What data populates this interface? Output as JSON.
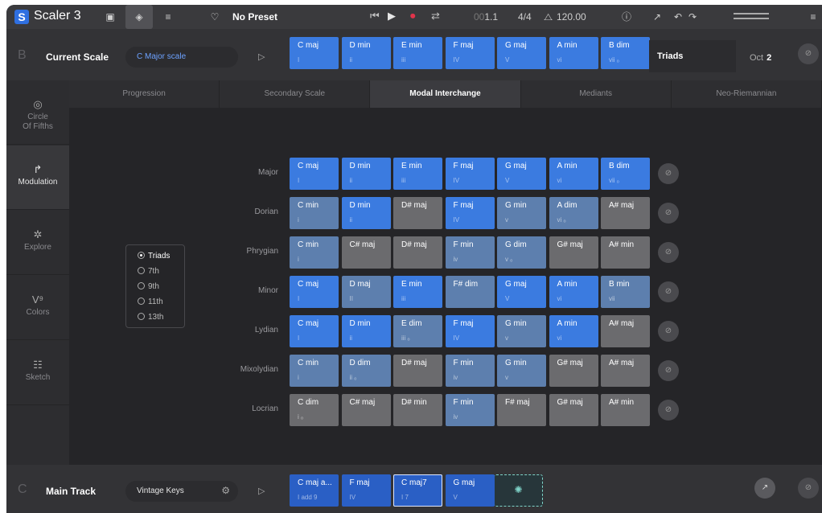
{
  "topbar": {
    "logo_letter": "S",
    "app_title": "Scaler 3",
    "preset": "No Preset",
    "position_dim": "00",
    "position": "1.1",
    "time_signature": "4/4",
    "tempo": "120.00",
    "tempo_icon": "metronome-icon"
  },
  "scale_row": {
    "letter": "B",
    "name": "Current Scale",
    "scale_value": "C Major scale",
    "chords": [
      {
        "name": "C maj",
        "roman": "I"
      },
      {
        "name": "D min",
        "roman": "ii"
      },
      {
        "name": "E min",
        "roman": "iii"
      },
      {
        "name": "F maj",
        "roman": "IV"
      },
      {
        "name": "G maj",
        "roman": "V"
      },
      {
        "name": "A min",
        "roman": "vi"
      },
      {
        "name": "B dim",
        "roman": "vii ₒ"
      }
    ],
    "chord_type": "Triads",
    "octave_label": "Oct",
    "octave_value": "2"
  },
  "sidebar": {
    "items": [
      {
        "label": "Circle\nOf Fifths",
        "icon": "◎"
      },
      {
        "label": "Modulation",
        "icon": "↱"
      },
      {
        "label": "Explore",
        "icon": "✲"
      },
      {
        "label": "Colors",
        "icon": "V⁹"
      },
      {
        "label": "Sketch",
        "icon": "☷"
      }
    ],
    "active_index": 1
  },
  "tabs": [
    "Progression",
    "Secondary Scale",
    "Modal Interchange",
    "Mediants",
    "Neo-Riemannian"
  ],
  "active_tab": 2,
  "modes": [
    {
      "name": "Major",
      "chords": [
        {
          "n": "C maj",
          "r": "I",
          "c": "blue"
        },
        {
          "n": "D min",
          "r": "ii",
          "c": "blue"
        },
        {
          "n": "E min",
          "r": "iii",
          "c": "blue"
        },
        {
          "n": "F maj",
          "r": "IV",
          "c": "blue"
        },
        {
          "n": "G maj",
          "r": "V",
          "c": "blue"
        },
        {
          "n": "A min",
          "r": "vi",
          "c": "blue"
        },
        {
          "n": "B dim",
          "r": "vii ₒ",
          "c": "blue"
        }
      ]
    },
    {
      "name": "Dorian",
      "chords": [
        {
          "n": "C min",
          "r": "i",
          "c": "slate"
        },
        {
          "n": "D min",
          "r": "ii",
          "c": "blue"
        },
        {
          "n": "D# maj",
          "r": "",
          "c": "gray"
        },
        {
          "n": "F maj",
          "r": "IV",
          "c": "blue"
        },
        {
          "n": "G min",
          "r": "v",
          "c": "slate"
        },
        {
          "n": "A dim",
          "r": "vi ₒ",
          "c": "slate"
        },
        {
          "n": "A# maj",
          "r": "",
          "c": "gray"
        }
      ]
    },
    {
      "name": "Phrygian",
      "chords": [
        {
          "n": "C min",
          "r": "i",
          "c": "slate"
        },
        {
          "n": "C# maj",
          "r": "",
          "c": "gray"
        },
        {
          "n": "D# maj",
          "r": "",
          "c": "gray"
        },
        {
          "n": "F min",
          "r": "iv",
          "c": "slate"
        },
        {
          "n": "G dim",
          "r": "v ₒ",
          "c": "slate"
        },
        {
          "n": "G# maj",
          "r": "",
          "c": "gray"
        },
        {
          "n": "A# min",
          "r": "",
          "c": "gray"
        }
      ]
    },
    {
      "name": "Minor",
      "chords": [
        {
          "n": "C maj",
          "r": "I",
          "c": "blue"
        },
        {
          "n": "D maj",
          "r": "II",
          "c": "slate"
        },
        {
          "n": "E min",
          "r": "iii",
          "c": "blue"
        },
        {
          "n": "F# dim",
          "r": "",
          "c": "slate"
        },
        {
          "n": "G maj",
          "r": "V",
          "c": "blue"
        },
        {
          "n": "A min",
          "r": "vi",
          "c": "blue"
        },
        {
          "n": "B min",
          "r": "vii",
          "c": "slate"
        }
      ]
    },
    {
      "name": "Lydian",
      "chords": [
        {
          "n": "C maj",
          "r": "I",
          "c": "blue"
        },
        {
          "n": "D min",
          "r": "ii",
          "c": "blue"
        },
        {
          "n": "E dim",
          "r": "iii ₒ",
          "c": "slate"
        },
        {
          "n": "F maj",
          "r": "IV",
          "c": "blue"
        },
        {
          "n": "G min",
          "r": "v",
          "c": "slate"
        },
        {
          "n": "A min",
          "r": "vi",
          "c": "blue"
        },
        {
          "n": "A# maj",
          "r": "",
          "c": "gray"
        }
      ]
    },
    {
      "name": "Mixolydian",
      "chords": [
        {
          "n": "C min",
          "r": "i",
          "c": "slate"
        },
        {
          "n": "D dim",
          "r": "ii ₒ",
          "c": "slate"
        },
        {
          "n": "D# maj",
          "r": "",
          "c": "gray"
        },
        {
          "n": "F min",
          "r": "iv",
          "c": "slate"
        },
        {
          "n": "G min",
          "r": "v",
          "c": "slate"
        },
        {
          "n": "G# maj",
          "r": "",
          "c": "gray"
        },
        {
          "n": "A# maj",
          "r": "",
          "c": "gray"
        }
      ]
    },
    {
      "name": "Locrian",
      "chords": [
        {
          "n": "C dim",
          "r": "i ₒ",
          "c": "gray"
        },
        {
          "n": "C# maj",
          "r": "",
          "c": "gray"
        },
        {
          "n": "D# min",
          "r": "",
          "c": "gray"
        },
        {
          "n": "F min",
          "r": "iv",
          "c": "slate"
        },
        {
          "n": "F# maj",
          "r": "",
          "c": "gray"
        },
        {
          "n": "G# maj",
          "r": "",
          "c": "gray"
        },
        {
          "n": "A# min",
          "r": "",
          "c": "gray"
        }
      ]
    }
  ],
  "chord_types": [
    "Triads",
    "7th",
    "9th",
    "11th",
    "13th"
  ],
  "selected_chord_type": 0,
  "track_row": {
    "letter": "C",
    "name": "Main Track",
    "instrument": "Vintage Keys",
    "chords": [
      {
        "name": "C maj a...",
        "roman": "I add 9"
      },
      {
        "name": "F maj",
        "roman": "IV"
      },
      {
        "name": "C maj7",
        "roman": "I 7"
      },
      {
        "name": "G maj",
        "roman": "V"
      }
    ],
    "idea_icon": "lightbulb-icon"
  },
  "colors": {
    "accent": "#3b7be0",
    "slate": "#5d7fae",
    "out_of_scale": "#6b6b6e",
    "idea": "#7fd3c8"
  }
}
